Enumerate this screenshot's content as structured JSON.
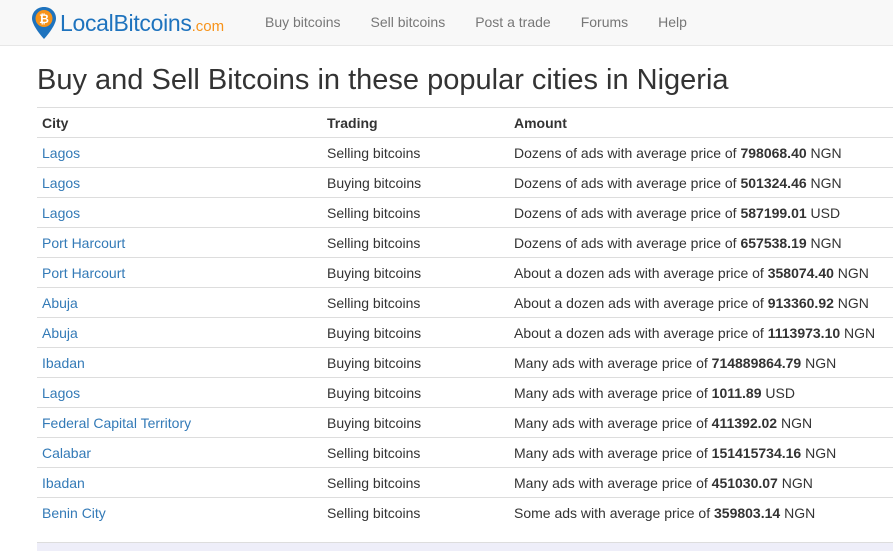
{
  "brand": {
    "name_main": "LocalBitcoins",
    "name_suffix": ".com"
  },
  "nav": {
    "items": [
      {
        "label": "Buy bitcoins"
      },
      {
        "label": "Sell bitcoins"
      },
      {
        "label": "Post a trade"
      },
      {
        "label": "Forums"
      },
      {
        "label": "Help"
      }
    ]
  },
  "page": {
    "title": "Buy and Sell Bitcoins in these popular cities in Nigeria"
  },
  "table": {
    "headers": {
      "city": "City",
      "trading": "Trading",
      "amount": "Amount"
    },
    "rows": [
      {
        "city": "Lagos",
        "trading": "Selling bitcoins",
        "amount_prefix": "Dozens of ads with average price of ",
        "price": "798068.40",
        "currency": "NGN"
      },
      {
        "city": "Lagos",
        "trading": "Buying bitcoins",
        "amount_prefix": "Dozens of ads with average price of ",
        "price": "501324.46",
        "currency": "NGN"
      },
      {
        "city": "Lagos",
        "trading": "Selling bitcoins",
        "amount_prefix": "Dozens of ads with average price of ",
        "price": "587199.01",
        "currency": "USD"
      },
      {
        "city": "Port Harcourt",
        "trading": "Selling bitcoins",
        "amount_prefix": "Dozens of ads with average price of ",
        "price": "657538.19",
        "currency": "NGN"
      },
      {
        "city": "Port Harcourt",
        "trading": "Buying bitcoins",
        "amount_prefix": "About a dozen ads with average price of ",
        "price": "358074.40",
        "currency": "NGN"
      },
      {
        "city": "Abuja",
        "trading": "Selling bitcoins",
        "amount_prefix": "About a dozen ads with average price of ",
        "price": "913360.92",
        "currency": "NGN"
      },
      {
        "city": "Abuja",
        "trading": "Buying bitcoins",
        "amount_prefix": "About a dozen ads with average price of ",
        "price": "1113973.10",
        "currency": "NGN"
      },
      {
        "city": "Ibadan",
        "trading": "Buying bitcoins",
        "amount_prefix": "Many ads with average price of ",
        "price": "714889864.79",
        "currency": "NGN"
      },
      {
        "city": "Lagos",
        "trading": "Buying bitcoins",
        "amount_prefix": "Many ads with average price of ",
        "price": "1011.89",
        "currency": "USD"
      },
      {
        "city": "Federal Capital Territory",
        "trading": "Buying bitcoins",
        "amount_prefix": "Many ads with average price of ",
        "price": "411392.02",
        "currency": "NGN"
      },
      {
        "city": "Calabar",
        "trading": "Selling bitcoins",
        "amount_prefix": "Many ads with average price of ",
        "price": "151415734.16",
        "currency": "NGN"
      },
      {
        "city": "Ibadan",
        "trading": "Selling bitcoins",
        "amount_prefix": "Many ads with average price of ",
        "price": "451030.07",
        "currency": "NGN"
      },
      {
        "city": "Benin City",
        "trading": "Selling bitcoins",
        "amount_prefix": "Some ads with average price of ",
        "price": "359803.14",
        "currency": "NGN"
      }
    ]
  },
  "colors": {
    "brand_blue": "#1e73be",
    "brand_orange": "#f7931a",
    "link": "#337ab7",
    "nav_text": "#777777",
    "navbar_bg": "#f8f8f8"
  }
}
